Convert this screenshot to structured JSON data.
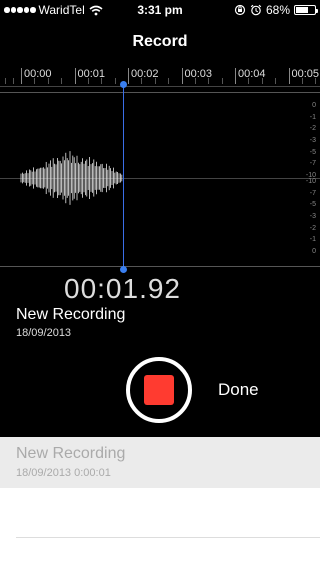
{
  "status_bar": {
    "carrier": "WaridTel",
    "time": "3:31 pm",
    "battery_percent_label": "68%",
    "battery_level": 0.68
  },
  "header": {
    "title": "Record"
  },
  "timeline": {
    "labels": [
      "00:00",
      "00:01",
      "00:02",
      "00:03",
      "00:04",
      "00:05"
    ]
  },
  "db_scale": {
    "upper": [
      "0",
      "-1",
      "-2",
      "-3",
      "-5",
      "-7",
      "-10"
    ],
    "lower": [
      "-10",
      "-7",
      "-5",
      "-3",
      "-2",
      "-1",
      "0"
    ]
  },
  "recorder": {
    "timer": "00:01.92",
    "recording_name": "New Recording",
    "recording_date": "18/09/2013",
    "done_label": "Done"
  },
  "recordings_list": {
    "items": [
      {
        "name": "New Recording",
        "meta": "18/09/2013  0:00:01"
      }
    ]
  },
  "colors": {
    "accent": "#3a7ff0",
    "record_red": "#ff3b30",
    "background": "#000000"
  }
}
